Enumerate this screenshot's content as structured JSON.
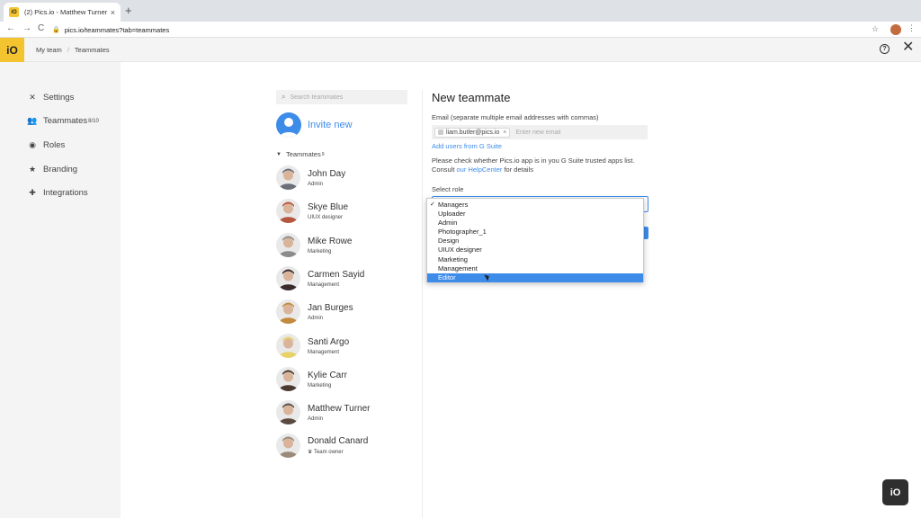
{
  "browser": {
    "tab_favicon": "iO",
    "tab_title": "(2) Pics.io - Matthew Turner",
    "tab_close": "×",
    "new_tab": "+",
    "back": "←",
    "forward": "→",
    "reload": "C",
    "lock": "🔒",
    "url": "pics.io/teammates?tab=teammates",
    "star": "☆",
    "menu": "⋮"
  },
  "header": {
    "logo": "iO",
    "breadcrumb": [
      "My team",
      "/",
      "Teammates"
    ],
    "help": "?",
    "close": "✕"
  },
  "sidebar": {
    "items": [
      {
        "label": "Settings",
        "icon": "✕",
        "icon_name": "tools-icon"
      },
      {
        "label": "Teammates",
        "icon": "👥",
        "icon_name": "people-icon",
        "count": "8/10"
      },
      {
        "label": "Roles",
        "icon": "◉",
        "icon_name": "eye-icon"
      },
      {
        "label": "Branding",
        "icon": "★",
        "icon_name": "star-icon"
      },
      {
        "label": "Integrations",
        "icon": "✚",
        "icon_name": "puzzle-icon"
      }
    ]
  },
  "list": {
    "search_placeholder": "Search teammates",
    "search_icon": "⌕",
    "invite_label": "Invite new",
    "teammates_caret": "▼",
    "teammates_label": "Teammates",
    "teammates_count": "9",
    "people": [
      {
        "name": "John Day",
        "role": "Admin",
        "color": "#6b6f78"
      },
      {
        "name": "Skye Blue",
        "role": "UIUX designer",
        "color": "#b5563f"
      },
      {
        "name": "Mike Rowe",
        "role": "Marketing",
        "color": "#8c8c8c"
      },
      {
        "name": "Carmen Sayid",
        "role": "Management",
        "color": "#3a2b2b"
      },
      {
        "name": "Jan Burges",
        "role": "Admin",
        "color": "#c28a3c"
      },
      {
        "name": "Santi Argo",
        "role": "Management",
        "color": "#e8d26a"
      },
      {
        "name": "Kylie Carr",
        "role": "Marketing",
        "color": "#4a3a30"
      },
      {
        "name": "Matthew Turner",
        "role": "Admin",
        "color": "#5a4a40"
      },
      {
        "name": "Donald Canard",
        "role": "♛ Team owner",
        "color": "#9a8a7a"
      }
    ]
  },
  "form": {
    "title": "New teammate",
    "email_label": "Email (separate multiple email addresses with commas)",
    "email_chip": "liam.butler@pics.io",
    "email_chip_remove": "×",
    "email_placeholder": "Enter new email",
    "gsuite_link": "Add users from G Suite",
    "note_line1": "Please check whether Pics.io app is in you G Suite trusted apps list.",
    "note_line2_prefix": "Consult ",
    "note_link": "our HelpCenter",
    "note_line2_suffix": " for details",
    "role_label": "Select role",
    "role_options": [
      "Managers",
      "Uploader",
      "Admin",
      "Photographer_1",
      "Design",
      "UIUX designer",
      "Marketing",
      "Management",
      "Editor"
    ],
    "role_checked": "✓",
    "accent_color": "#3d8cea"
  },
  "floating": {
    "logo": "iO"
  }
}
